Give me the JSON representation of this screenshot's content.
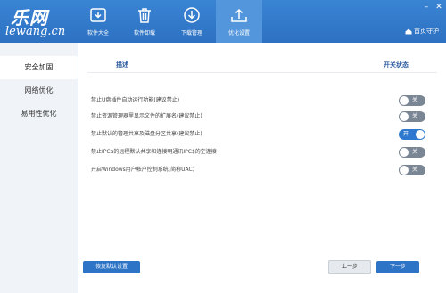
{
  "app": {
    "logo_cn": "乐网",
    "logo_en": "lewang.cn",
    "home_label": "首页守护"
  },
  "window_controls": {
    "minimize": "–",
    "close": "✕"
  },
  "tabs": [
    {
      "label": "软件大全",
      "icon": "download-box-icon"
    },
    {
      "label": "软件卸载",
      "icon": "trash-icon"
    },
    {
      "label": "下载管理",
      "icon": "download-circle-icon"
    },
    {
      "label": "优化设置",
      "icon": "upload-tray-icon",
      "active": true
    }
  ],
  "sidebar": {
    "items": [
      {
        "label": "安全加固",
        "active": true
      },
      {
        "label": "网络优化"
      },
      {
        "label": "易用性优化"
      }
    ]
  },
  "table": {
    "col_desc": "描述",
    "col_status": "开关状态",
    "rows": [
      {
        "text": "禁止U盘插件自动运行功能(建议禁止)",
        "state": "关",
        "on": false
      },
      {
        "text": "禁止资源管理器里显示文件的扩展名(建议禁止)",
        "state": "关",
        "on": false
      },
      {
        "text": "禁止默认的管理共享及磁盘分区共享(建议禁止)",
        "state": "开",
        "on": true
      },
      {
        "text": "禁止IPC$的远程默认共享和连接明通讯IPC$的空连接",
        "state": "关",
        "on": false
      },
      {
        "text": "开启Windows用户帐户控制系统(简称UAC)",
        "state": "关",
        "on": false
      }
    ]
  },
  "buttons": {
    "restore_default": "恢复默认设置",
    "prev": "上一步",
    "next": "下一步"
  },
  "colors": {
    "titlebar": "#2d71c2",
    "accent": "#2e79cf",
    "toggle_off": "#7b8694"
  }
}
